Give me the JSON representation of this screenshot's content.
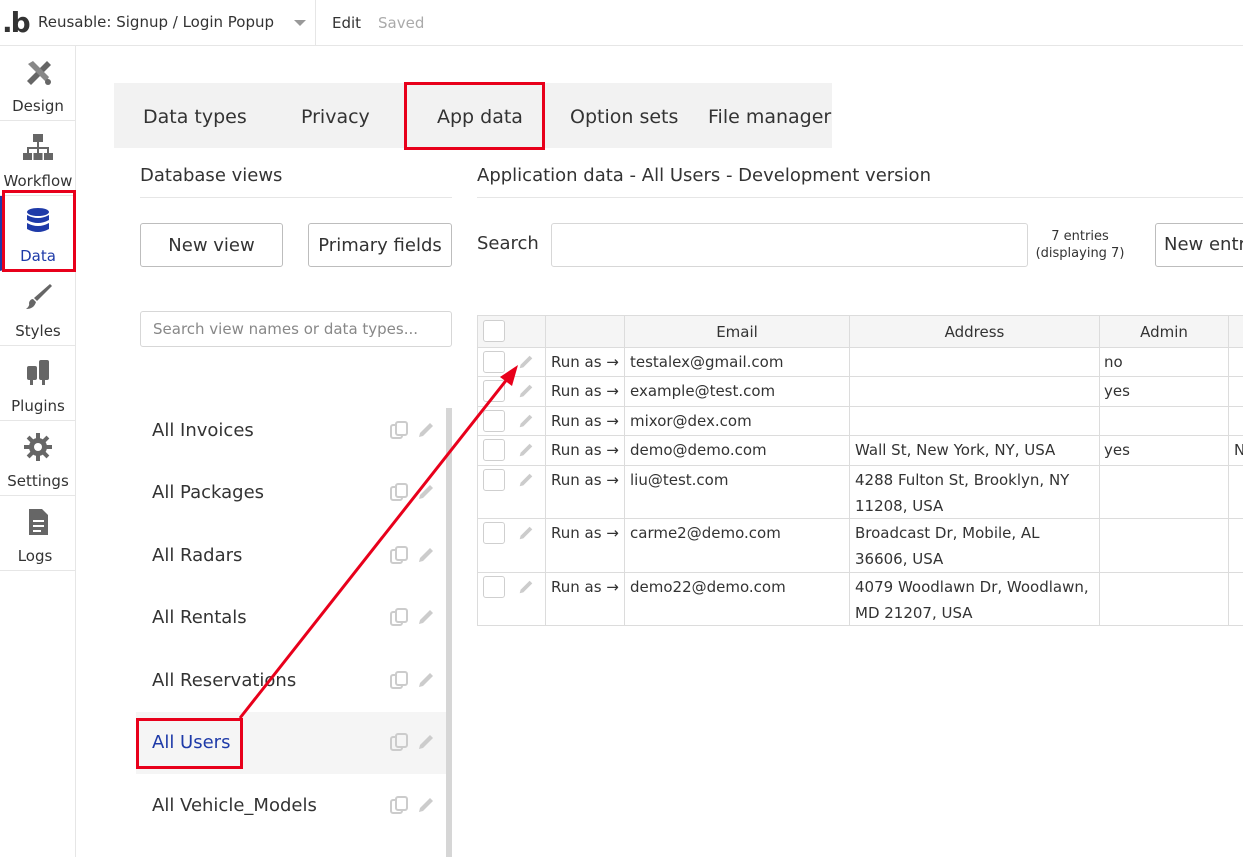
{
  "topbar": {
    "logo": ".b",
    "page_name": "Reusable: Signup / Login Popup",
    "edit_label": "Edit",
    "status": "Saved"
  },
  "rail": [
    {
      "label": "Design",
      "icon": "design-icon"
    },
    {
      "label": "Workflow",
      "icon": "workflow-icon"
    },
    {
      "label": "Data",
      "icon": "database-icon"
    },
    {
      "label": "Styles",
      "icon": "brush-icon"
    },
    {
      "label": "Plugins",
      "icon": "plug-icon"
    },
    {
      "label": "Settings",
      "icon": "gear-icon"
    },
    {
      "label": "Logs",
      "icon": "document-icon"
    }
  ],
  "tabs": [
    "Data types",
    "Privacy",
    "App data",
    "Option sets",
    "File manager"
  ],
  "left_panel": {
    "title": "Database views",
    "new_view_label": "New view",
    "primary_fields_label": "Primary fields",
    "search_placeholder": "Search view names or data types...",
    "views": [
      "All Invoices",
      "All Packages",
      "All Radars",
      "All Rentals",
      "All Reservations",
      "All Users",
      "All Vehicle_Models"
    ],
    "selected_view": "All Users"
  },
  "right_panel": {
    "title": "Application data - All Users - Development version",
    "search_label": "Search",
    "entries_line1": "7 entries",
    "entries_line2": "(displaying 7)",
    "new_entry_label": "New entry"
  },
  "table": {
    "columns": [
      "Email",
      "Address",
      "Admin"
    ],
    "rows": [
      {
        "run_as": "Run as →",
        "email": "testalex@gmail.com",
        "address": "",
        "admin": "no",
        "extra": ""
      },
      {
        "run_as": "Run as →",
        "email": "example@test.com",
        "address": "",
        "admin": "yes",
        "extra": ""
      },
      {
        "run_as": "Run as →",
        "email": "mixor@dex.com",
        "address": "",
        "admin": "",
        "extra": ""
      },
      {
        "run_as": "Run as →",
        "email": "demo@demo.com",
        "address": "Wall St, New York, NY, USA",
        "admin": "yes",
        "extra": "N"
      },
      {
        "run_as": "Run as →",
        "email": "liu@test.com",
        "address": "4288 Fulton St, Brooklyn, NY 11208, USA",
        "admin": "",
        "extra": ""
      },
      {
        "run_as": "Run as →",
        "email": "carme2@demo.com",
        "address": "Broadcast Dr, Mobile, AL 36606, USA",
        "admin": "",
        "extra": ""
      },
      {
        "run_as": "Run as →",
        "email": "demo22@demo.com",
        "address": "4079 Woodlawn Dr, Woodlawn, MD 21207, USA",
        "admin": "",
        "extra": ""
      }
    ]
  },
  "colors": {
    "highlight": "#e8001b",
    "accent": "#1e3aa8",
    "tab_bg": "#f2f2f2"
  }
}
